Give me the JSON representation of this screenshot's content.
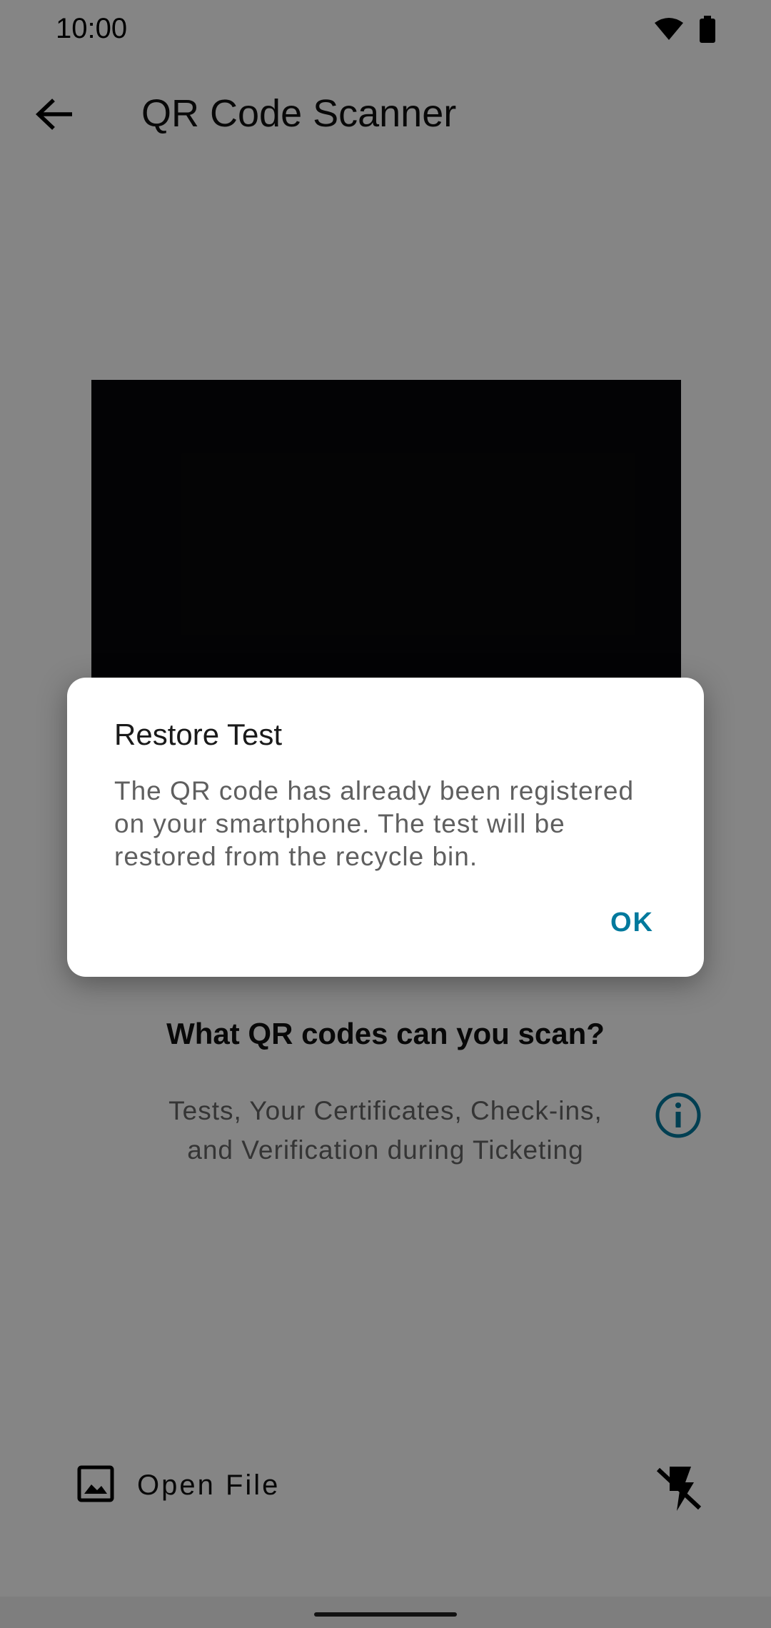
{
  "status_bar": {
    "time": "10:00",
    "icons": [
      "wifi-icon",
      "battery-icon"
    ]
  },
  "app_bar": {
    "title": "QR Code Scanner",
    "back_icon": "arrow-back-icon"
  },
  "info": {
    "heading": "What QR codes can you scan?",
    "description": "Tests, Your Certificates, Check-ins, and Verification during Ticketing",
    "info_icon": "info-icon"
  },
  "actions": {
    "open_file_label": "Open File",
    "open_file_icon": "image-icon",
    "flash_icon": "flash-off-icon"
  },
  "dialog": {
    "title": "Restore Test",
    "message": "The QR code has already been registered on your smartphone. The test will be restored from the recycle bin.",
    "ok_label": "OK"
  },
  "colors": {
    "accent": "#00799d",
    "scrim": "rgba(0,0,0,0.48)",
    "camera_bg": "#07070a"
  }
}
